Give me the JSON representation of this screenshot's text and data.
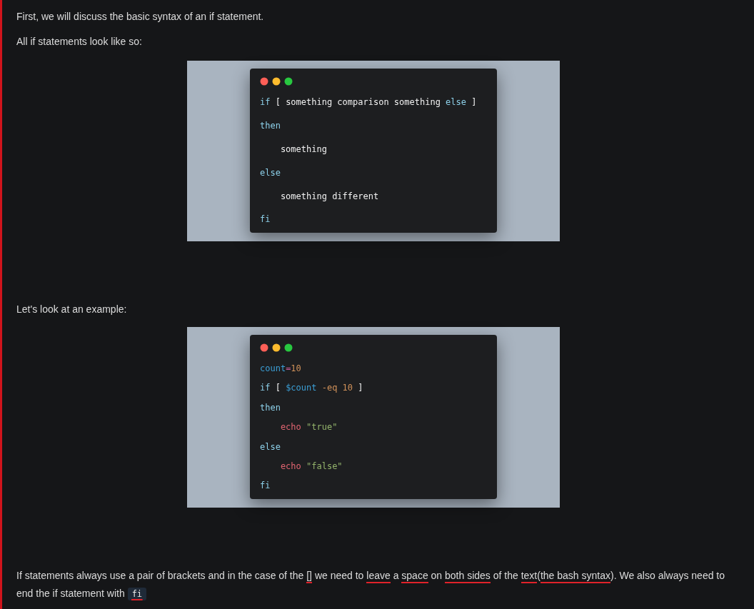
{
  "blocks": [
    {
      "kind": "paragraph",
      "segments": [
        {
          "kind": "text",
          "text": "First, we will discuss the basic syntax of an if statement.",
          "underlined": false
        }
      ]
    },
    {
      "kind": "paragraph",
      "segments": [
        {
          "kind": "text",
          "text": "All if statements look like so:",
          "underlined": false
        }
      ]
    },
    {
      "kind": "code_image",
      "lines": [
        {
          "tokens": [
            {
              "kind": "keyword",
              "text": "if"
            },
            {
              "kind": "plain",
              "text": " [ something comparison something "
            },
            {
              "kind": "keyword",
              "text": "else"
            },
            {
              "kind": "plain",
              "text": " ]"
            }
          ]
        },
        {
          "tokens": [
            {
              "kind": "keyword",
              "text": "then"
            }
          ]
        },
        {
          "tokens": [
            {
              "kind": "plain",
              "text": "    something"
            }
          ]
        },
        {
          "tokens": [
            {
              "kind": "keyword",
              "text": "else"
            }
          ]
        },
        {
          "tokens": [
            {
              "kind": "plain",
              "text": "    something different"
            }
          ]
        },
        {
          "tokens": [
            {
              "kind": "keyword",
              "text": "fi"
            }
          ]
        }
      ]
    },
    {
      "kind": "paragraph",
      "segments": [
        {
          "kind": "text",
          "text": "Let's look at an example:",
          "underlined": false
        }
      ]
    },
    {
      "kind": "code_image",
      "lines": [
        {
          "tokens": [
            {
              "kind": "variable",
              "text": "count"
            },
            {
              "kind": "operator",
              "text": "="
            },
            {
              "kind": "number",
              "text": "10"
            }
          ]
        },
        {
          "tokens": [
            {
              "kind": "keyword",
              "text": "if"
            },
            {
              "kind": "plain",
              "text": " [ "
            },
            {
              "kind": "variable",
              "text": "$count"
            },
            {
              "kind": "number",
              "text": " -eq 10"
            },
            {
              "kind": "plain",
              "text": " ]"
            }
          ]
        },
        {
          "tokens": [
            {
              "kind": "keyword",
              "text": "then"
            }
          ]
        },
        {
          "tokens": [
            {
              "kind": "command",
              "text": "    echo"
            },
            {
              "kind": "string",
              "text": " \"true\""
            }
          ]
        },
        {
          "tokens": [
            {
              "kind": "keyword",
              "text": "else"
            }
          ]
        },
        {
          "tokens": [
            {
              "kind": "command",
              "text": "    echo"
            },
            {
              "kind": "string",
              "text": " \"false\""
            }
          ]
        },
        {
          "tokens": [
            {
              "kind": "keyword",
              "text": "fi"
            }
          ]
        }
      ]
    },
    {
      "kind": "paragraph",
      "segments": [
        {
          "kind": "text",
          "text": "If statements always use a pair of brackets and in the case of the ",
          "underlined": false
        },
        {
          "kind": "text",
          "text": "[]",
          "underlined": true
        },
        {
          "kind": "text",
          "text": " we need to ",
          "underlined": false
        },
        {
          "kind": "text",
          "text": "leave",
          "underlined": true
        },
        {
          "kind": "text",
          "text": " a ",
          "underlined": false
        },
        {
          "kind": "text",
          "text": "space",
          "underlined": true
        },
        {
          "kind": "text",
          "text": " on ",
          "underlined": false
        },
        {
          "kind": "text",
          "text": "both sides",
          "underlined": true
        },
        {
          "kind": "text",
          "text": " of the ",
          "underlined": false
        },
        {
          "kind": "text",
          "text": "text",
          "underlined": true
        },
        {
          "kind": "text",
          "text": "(",
          "underlined": false
        },
        {
          "kind": "text",
          "text": "the bash syntax",
          "underlined": true
        },
        {
          "kind": "text",
          "text": "). We also always need to end the if statement with ",
          "underlined": false
        },
        {
          "kind": "code",
          "text": "fi",
          "underlined": true
        }
      ]
    }
  ]
}
